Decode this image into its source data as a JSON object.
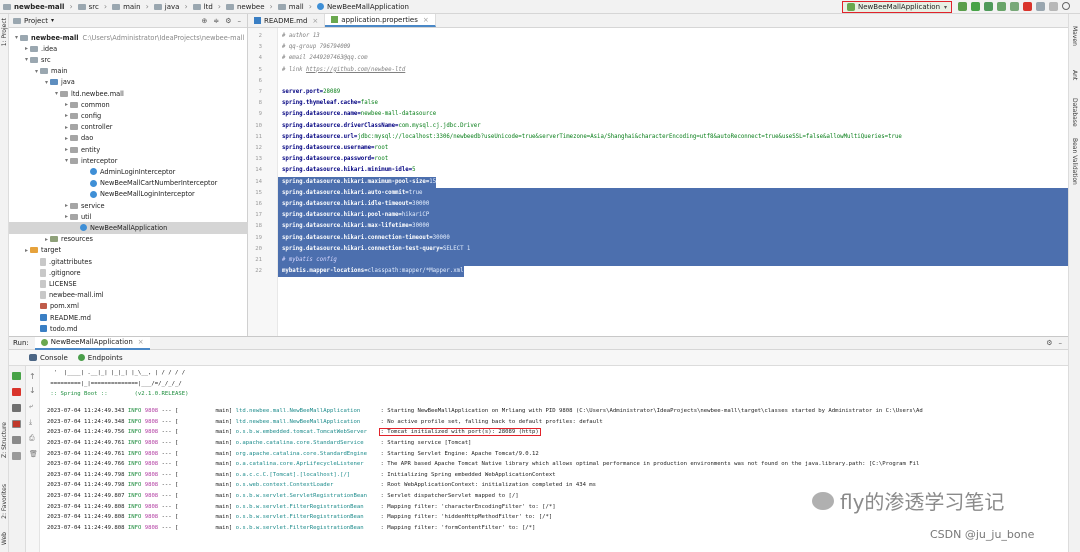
{
  "breadcrumb": [
    "newbee-mall",
    "src",
    "main",
    "java",
    "ltd",
    "newbee",
    "mall",
    "NewBeeMallApplication"
  ],
  "run_config": "NewBeeMallApplication",
  "left_strip": {
    "project": "1: Project",
    "structure": "Z: Structure",
    "favorites": "2: Favorites",
    "web": "Web"
  },
  "right_strip": [
    "Maven",
    "Ant",
    "Database",
    "Bean Validation"
  ],
  "project_panel": {
    "title": "Project",
    "tree": [
      {
        "label": "newbee-mall",
        "path": "C:\\Users\\Administrator\\IdeaProjects\\newbee-mall",
        "depth": 0,
        "arrow": "▾",
        "icon": "folder",
        "bold": true
      },
      {
        "label": ".idea",
        "depth": 1,
        "arrow": "▸",
        "icon": "folder"
      },
      {
        "label": "src",
        "depth": 1,
        "arrow": "▾",
        "icon": "folder"
      },
      {
        "label": "main",
        "depth": 2,
        "arrow": "▾",
        "icon": "folder"
      },
      {
        "label": "java",
        "depth": 3,
        "arrow": "▾",
        "icon": "src"
      },
      {
        "label": "ltd.newbee.mall",
        "depth": 4,
        "arrow": "▾",
        "icon": "pkg"
      },
      {
        "label": "common",
        "depth": 5,
        "arrow": "▸",
        "icon": "pkg"
      },
      {
        "label": "config",
        "depth": 5,
        "arrow": "▸",
        "icon": "pkg"
      },
      {
        "label": "controller",
        "depth": 5,
        "arrow": "▸",
        "icon": "pkg"
      },
      {
        "label": "dao",
        "depth": 5,
        "arrow": "▸",
        "icon": "pkg"
      },
      {
        "label": "entity",
        "depth": 5,
        "arrow": "▸",
        "icon": "pkg"
      },
      {
        "label": "interceptor",
        "depth": 5,
        "arrow": "▾",
        "icon": "pkg"
      },
      {
        "label": "AdminLoginInterceptor",
        "depth": 7,
        "arrow": "",
        "icon": "cls"
      },
      {
        "label": "NewBeeMallCartNumberInterceptor",
        "depth": 7,
        "arrow": "",
        "icon": "cls"
      },
      {
        "label": "NewBeeMallLoginInterceptor",
        "depth": 7,
        "arrow": "",
        "icon": "cls"
      },
      {
        "label": "service",
        "depth": 5,
        "arrow": "▸",
        "icon": "pkg"
      },
      {
        "label": "util",
        "depth": 5,
        "arrow": "▸",
        "icon": "pkg"
      },
      {
        "label": "NewBeeMallApplication",
        "depth": 6,
        "arrow": "",
        "icon": "cls",
        "selected": true
      },
      {
        "label": "resources",
        "depth": 3,
        "arrow": "▸",
        "icon": "res"
      },
      {
        "label": "target",
        "depth": 1,
        "arrow": "▸",
        "icon": "tgt"
      },
      {
        "label": ".gitattributes",
        "depth": 2,
        "arrow": "",
        "icon": "file"
      },
      {
        "label": ".gitignore",
        "depth": 2,
        "arrow": "",
        "icon": "file"
      },
      {
        "label": "LICENSE",
        "depth": 2,
        "arrow": "",
        "icon": "file"
      },
      {
        "label": "newbee-mall.iml",
        "depth": 2,
        "arrow": "",
        "icon": "file"
      },
      {
        "label": "pom.xml",
        "depth": 2,
        "arrow": "",
        "icon": "mvn"
      },
      {
        "label": "README.md",
        "depth": 2,
        "arrow": "",
        "icon": "md"
      },
      {
        "label": "todo.md",
        "depth": 2,
        "arrow": "",
        "icon": "md"
      }
    ]
  },
  "editor_tabs": [
    {
      "label": "README.md",
      "active": false
    },
    {
      "label": "application.properties",
      "active": true
    }
  ],
  "code_lines": [
    {
      "n": "2",
      "kind": "comment",
      "text": "# author 13"
    },
    {
      "n": "3",
      "kind": "comment",
      "text": "# qq-group 796794009"
    },
    {
      "n": "4",
      "kind": "comment",
      "text": "# email 2449207463@qq.com"
    },
    {
      "n": "5",
      "kind": "comment-link",
      "text": "# link ",
      "link": "https://github.com/newbee-ltd"
    },
    {
      "n": "6",
      "kind": "blank",
      "text": ""
    },
    {
      "n": "7",
      "kind": "prop",
      "key": "server.port",
      "value": "28089"
    },
    {
      "n": "8",
      "kind": "prop",
      "key": "spring.thymeleaf.cache",
      "value": "false"
    },
    {
      "n": "9",
      "kind": "prop",
      "key": "spring.datasource.name",
      "value": "newbee-mall-datasource"
    },
    {
      "n": "10",
      "kind": "prop",
      "key": "spring.datasource.driverClassName",
      "value": "com.mysql.cj.jdbc.Driver"
    },
    {
      "n": "11",
      "kind": "prop",
      "key": "spring.datasource.url",
      "value": "jdbc:mysql://localhost:3306/newbeedb?useUnicode=true&serverTimezone=Asia/Shanghai&characterEncoding=utf8&autoReconnect=true&useSSL=false&allowMultiQueries=true"
    },
    {
      "n": "12",
      "kind": "prop",
      "key": "spring.datasource.username",
      "value": "root"
    },
    {
      "n": "13",
      "kind": "prop",
      "key": "spring.datasource.password",
      "value": "root"
    },
    {
      "n": "14",
      "kind": "prop",
      "key": "spring.datasource.hikari.minimum-idle",
      "value": "5"
    },
    {
      "n": "14",
      "kind": "prop",
      "key": "spring.datasource.hikari.maximum-pool-size",
      "value": "15",
      "sel": "partial"
    },
    {
      "n": "15",
      "kind": "prop",
      "key": "spring.datasource.hikari.auto-commit",
      "value": "true",
      "sel": "full"
    },
    {
      "n": "16",
      "kind": "prop",
      "key": "spring.datasource.hikari.idle-timeout",
      "value": "30000",
      "sel": "full"
    },
    {
      "n": "17",
      "kind": "prop",
      "key": "spring.datasource.hikari.pool-name",
      "value": "hikariCP",
      "sel": "full"
    },
    {
      "n": "18",
      "kind": "prop",
      "key": "spring.datasource.hikari.max-lifetime",
      "value": "30000",
      "sel": "full"
    },
    {
      "n": "19",
      "kind": "prop",
      "key": "spring.datasource.hikari.connection-timeout",
      "value": "30000",
      "sel": "full"
    },
    {
      "n": "20",
      "kind": "prop",
      "key": "spring.datasource.hikari.connection-test-query",
      "value": "SELECT 1",
      "sel": "full"
    },
    {
      "n": "21",
      "kind": "comment",
      "text": "# mybatis config",
      "sel": "full"
    },
    {
      "n": "22",
      "kind": "prop",
      "key": "mybatis.mapper-locations",
      "value": "classpath:mapper/*Mapper.xml",
      "sel": "partial-end"
    }
  ],
  "run_panel": {
    "run_label": "Run:",
    "tab": "NewBeeMallApplication",
    "sub_tabs": [
      "Console",
      "Endpoints"
    ]
  },
  "banner": [
    "  '  |____| .__|_| |_|_| |_\\__, | / / / /",
    " =========|_|==============|___/=/_/_/_/",
    " :: Spring Boot ::        (v2.1.0.RELEASE)"
  ],
  "log_lines": [
    {
      "ts": "2023-07-04 11:24:49.343",
      "lvl": "INFO",
      "pid": "9808",
      "thread": "--- [           main]",
      "logger": "ltd.newbee.mall.NewBeeMallApplication     ",
      "msg": ": Starting NewBeeMallApplication on Mrliang with PID 9808 (C:\\Users\\Administrator\\IdeaProjects\\newbee-mall\\target\\classes started by Administrator in C:\\Users\\Ad"
    },
    {
      "ts": "2023-07-04 11:24:49.348",
      "lvl": "INFO",
      "pid": "9808",
      "thread": "--- [           main]",
      "logger": "ltd.newbee.mall.NewBeeMallApplication     ",
      "msg": ": No active profile set, falling back to default profiles: default"
    },
    {
      "ts": "2023-07-04 11:24:49.756",
      "lvl": "INFO",
      "pid": "9808",
      "thread": "--- [           main]",
      "logger": "o.s.b.w.embedded.tomcat.TomcatWebServer   ",
      "msg": ": Tomcat initialized with port(s): 28089 (http)"
    },
    {
      "ts": "2023-07-04 11:24:49.761",
      "lvl": "INFO",
      "pid": "9808",
      "thread": "--- [           main]",
      "logger": "o.apache.catalina.core.StandardService    ",
      "msg": ": Starting service [Tomcat]"
    },
    {
      "ts": "2023-07-04 11:24:49.761",
      "lvl": "INFO",
      "pid": "9808",
      "thread": "--- [           main]",
      "logger": "org.apache.catalina.core.StandardEngine   ",
      "msg": ": Starting Servlet Engine: Apache Tomcat/9.0.12"
    },
    {
      "ts": "2023-07-04 11:24:49.766",
      "lvl": "INFO",
      "pid": "9808",
      "thread": "--- [           main]",
      "logger": "o.a.catalina.core.AprLifecycleListener    ",
      "msg": ": The APR based Apache Tomcat Native library which allows optimal performance in production environments was not found on the java.library.path: [C:\\Program Fil"
    },
    {
      "ts": "2023-07-04 11:24:49.798",
      "lvl": "INFO",
      "pid": "9808",
      "thread": "--- [           main]",
      "logger": "o.a.c.c.C.[Tomcat].[localhost].[/]        ",
      "msg": ": Initializing Spring embedded WebApplicationContext"
    },
    {
      "ts": "2023-07-04 11:24:49.798",
      "lvl": "INFO",
      "pid": "9808",
      "thread": "--- [           main]",
      "logger": "o.s.web.context.ContextLoader             ",
      "msg": ": Root WebApplicationContext: initialization completed in 434 ms"
    },
    {
      "ts": "2023-07-04 11:24:49.807",
      "lvl": "INFO",
      "pid": "9808",
      "thread": "--- [           main]",
      "logger": "o.s.b.w.servlet.ServletRegistrationBean   ",
      "msg": ": Servlet dispatcherServlet mapped to [/]"
    },
    {
      "ts": "2023-07-04 11:24:49.808",
      "lvl": "INFO",
      "pid": "9808",
      "thread": "--- [           main]",
      "logger": "o.s.b.w.servlet.FilterRegistrationBean    ",
      "msg": ": Mapping filter: 'characterEncodingFilter' to: [/*]"
    },
    {
      "ts": "2023-07-04 11:24:49.808",
      "lvl": "INFO",
      "pid": "9808",
      "thread": "--- [           main]",
      "logger": "o.s.b.w.servlet.FilterRegistrationBean    ",
      "msg": ": Mapping filter: 'hiddenHttpMethodFilter' to: [/*]"
    },
    {
      "ts": "2023-07-04 11:24:49.808",
      "lvl": "INFO",
      "pid": "9808",
      "thread": "--- [           main]",
      "logger": "o.s.b.w.servlet.FilterRegistrationBean    ",
      "msg": ": Mapping filter: 'formContentFilter' to: [/*]"
    }
  ],
  "watermark": {
    "wechat": "fly的渗透学习笔记",
    "csdn": "CSDN @ju_ju_bone"
  },
  "colors": {
    "selection": "#4c6fae",
    "highlight_box": "#e1232b",
    "info": "#1c8c3c",
    "pid": "#b03aa0",
    "logger": "#1c8b8b"
  }
}
